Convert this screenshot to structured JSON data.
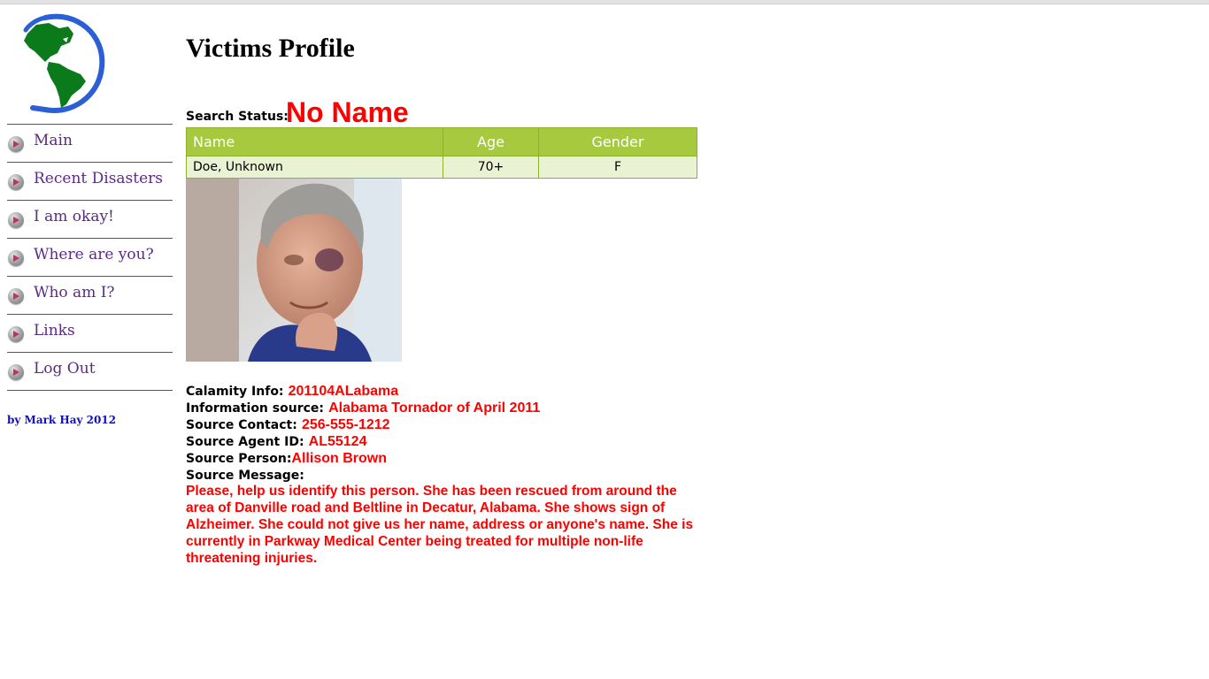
{
  "sidebar": {
    "logo_icon": "globe-americas-icon",
    "items": [
      {
        "label": "Main"
      },
      {
        "label": "Recent Disasters"
      },
      {
        "label": "I am okay!"
      },
      {
        "label": "Where are you?"
      },
      {
        "label": "Who am I?"
      },
      {
        "label": "Links"
      },
      {
        "label": "Log Out"
      }
    ],
    "credit": "by Mark Hay 2012"
  },
  "main": {
    "title": "Victims Profile",
    "search_status_label": "Search Status:",
    "search_status_value": "No Name",
    "table": {
      "headers": [
        "Name",
        "Age",
        "Gender"
      ],
      "rows": [
        [
          "Doe, Unknown",
          "70+",
          "F"
        ]
      ]
    },
    "info": {
      "calamity_label": "Calamity Info:",
      "calamity_value": "201104ALabama",
      "source_label": "Information source:",
      "source_value": "Alabama Tornador of April 2011",
      "contact_label": "Source Contact:",
      "contact_value": "256-555-1212",
      "agent_label": "Source Agent ID:",
      "agent_value": "AL55124",
      "person_label": "Source Person:",
      "person_value": "Allison Brown",
      "message_label": "Source Message:",
      "message_value": "Please, help us identify this person. She has been rescued from around the area of Danville road and Beltline in Decatur, Alabama. She shows sign of Alzheimer. She could not give us her name, address or anyone's name. She is currently in Parkway Medical Center being treated for multiple non-life threatening injuries."
    }
  },
  "colors": {
    "accent_green": "#a6c93f",
    "alert_red": "#ff0000",
    "nav_link": "#5b2a86",
    "credit_blue": "#1010c0"
  }
}
